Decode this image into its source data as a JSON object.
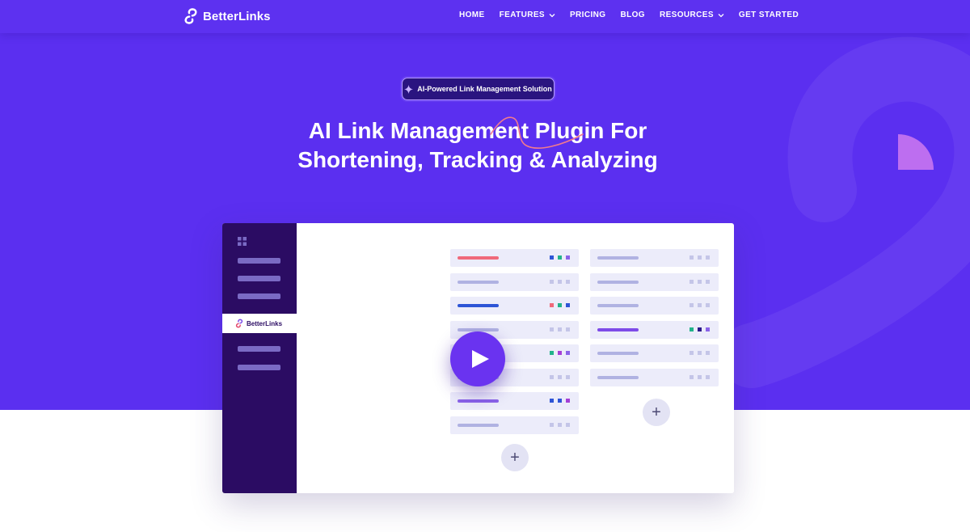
{
  "brand": {
    "name": "BetterLinks"
  },
  "nav": {
    "items": [
      {
        "label": "HOME",
        "dropdown": false
      },
      {
        "label": "FEATURES",
        "dropdown": true
      },
      {
        "label": "PRICING",
        "dropdown": false
      },
      {
        "label": "BLOG",
        "dropdown": false
      },
      {
        "label": "RESOURCES",
        "dropdown": true
      },
      {
        "label": "GET STARTED",
        "dropdown": false
      }
    ]
  },
  "hero": {
    "badge": "AI-Powered Link Management Solution",
    "title_line1": "AI Link Management Plugin For",
    "title_line2": "Shortening, Tracking & Analyzing"
  },
  "video_preview": {
    "sidebar_active_label": "BetterLinks",
    "play_icon": "play-icon",
    "add_icon_label": "+"
  },
  "colors": {
    "hero_bg": "#5b2ff0",
    "accent_red": "#f0697a",
    "accent_blue": "#2e55d6",
    "accent_purple": "#7d4ae8",
    "mock_sidebar": "#2b0c63"
  }
}
